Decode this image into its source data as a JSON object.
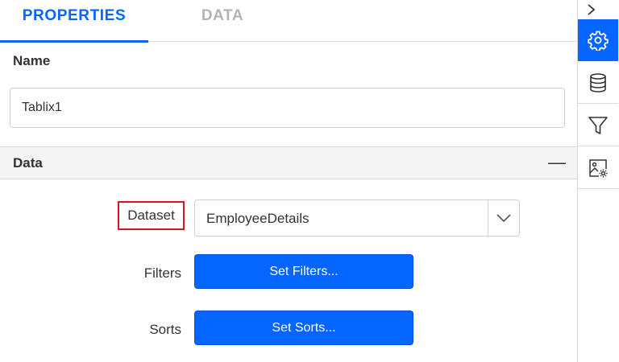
{
  "tabs": [
    {
      "label": "PROPERTIES",
      "active": true
    },
    {
      "label": "DATA",
      "active": false
    }
  ],
  "name_section": {
    "label": "Name",
    "value": "Tablix1"
  },
  "data_section": {
    "title": "Data",
    "collapse_glyph": "—",
    "dataset_label": "Dataset",
    "dataset_value": "EmployeeDetails",
    "filters_label": "Filters",
    "filters_button": "Set Filters...",
    "sorts_label": "Sorts",
    "sorts_button": "Set Sorts..."
  },
  "rail": {
    "toggle_icon": "chevron-right-icon",
    "items": [
      {
        "icon": "gear-icon",
        "active": true
      },
      {
        "icon": "database-icon",
        "active": false
      },
      {
        "icon": "filter-icon",
        "active": false
      },
      {
        "icon": "image-settings-icon",
        "active": false
      }
    ]
  },
  "colors": {
    "accent": "#0565ff",
    "highlight_border": "#e0141e",
    "section_bg": "#f4f4f4",
    "inactive_tab": "#b3b3b3"
  }
}
